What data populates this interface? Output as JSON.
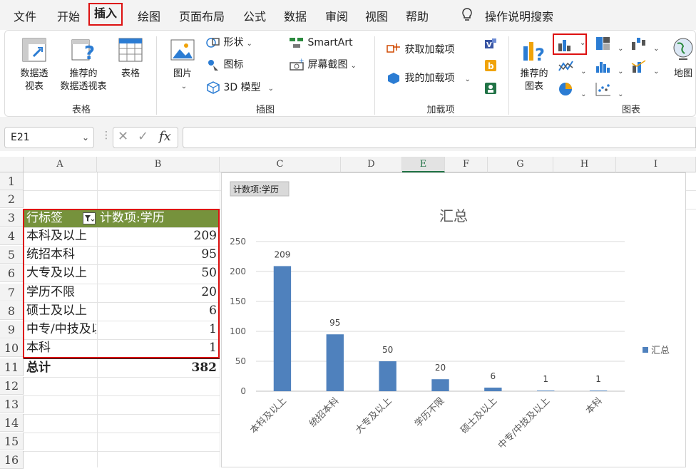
{
  "menu": {
    "items": [
      "文件",
      "开始",
      "插入",
      "绘图",
      "页面布局",
      "公式",
      "数据",
      "审阅",
      "视图",
      "帮助"
    ],
    "active": "插入",
    "search": "操作说明搜索"
  },
  "ribbon": {
    "pivot_table": "数据透\n视表",
    "recommended_pivot": "推荐的\n数据透视表",
    "table": "表格",
    "group_tables": "表格",
    "picture": "图片",
    "shapes": "形状",
    "icons": "图标",
    "model3d": "3D 模型",
    "smartart": "SmartArt",
    "screenshot": "屏幕截图",
    "group_illustrations": "插图",
    "get_addins": "获取加载项",
    "my_addins": "我的加载项",
    "group_addins": "加载项",
    "recommended_charts": "推荐的\n图表",
    "maps": "地图",
    "group_charts": "图表"
  },
  "formula": {
    "namebox": "E21",
    "fx": "fx",
    "value": ""
  },
  "sheet": {
    "columns": [
      "A",
      "B",
      "C",
      "D",
      "E",
      "F",
      "G",
      "H",
      "I"
    ],
    "selected_column": "E",
    "rows": [
      "1",
      "2",
      "3",
      "4",
      "5",
      "6",
      "7",
      "8",
      "9",
      "10",
      "11",
      "12",
      "13",
      "14",
      "15",
      "16"
    ],
    "pivot": {
      "header_label": "行标签",
      "header_value": "计数项:学历",
      "rows": [
        {
          "label": "本科及以上",
          "value": "209"
        },
        {
          "label": "统招本科",
          "value": "95"
        },
        {
          "label": "大专及以上",
          "value": "50"
        },
        {
          "label": "学历不限",
          "value": "20"
        },
        {
          "label": "硕士及以上",
          "value": "6"
        },
        {
          "label": "中专/中技及以上",
          "value": "1"
        },
        {
          "label": "本科",
          "value": "1"
        }
      ],
      "total_label": "总计",
      "total_value": "382",
      "header_color": "#76923c"
    }
  },
  "chart_data": {
    "type": "bar",
    "field_button": "计数项:学历",
    "title": "汇总",
    "categories": [
      "本科及以上",
      "统招本科",
      "大专及以上",
      "学历不限",
      "硕士及以上",
      "中专/中技及以上",
      "本科"
    ],
    "series": [
      {
        "name": "汇总",
        "values": [
          209,
          95,
          50,
          20,
          6,
          1,
          1
        ],
        "color": "#4f81bd"
      }
    ],
    "ylim": [
      0,
      250
    ],
    "yticks": [
      0,
      50,
      100,
      150,
      200,
      250
    ],
    "legend_position": "right",
    "grid": true
  }
}
